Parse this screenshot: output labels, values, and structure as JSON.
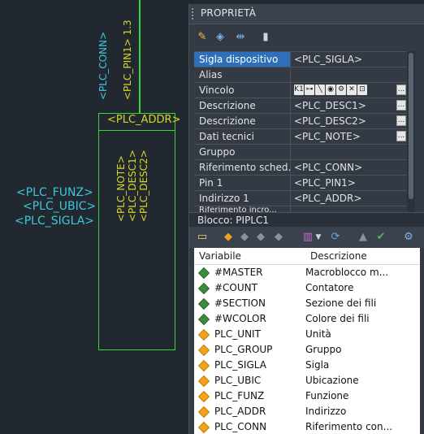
{
  "canvas": {
    "attributes": {
      "conn": "<PLC_CONN>",
      "pin1": "<PLC_PIN1> 1.3",
      "addr": "<PLC_ADDR>",
      "note": "<PLC_NOTE>",
      "desc1": "<PLC_DESC1>",
      "desc2": "<PLC_DESC2>",
      "funz": "<PLC_FUNZ>",
      "ubic": "<PLC_UBIC>",
      "sigla": "<PLC_SIGLA>"
    },
    "colors": {
      "wire": "#3fd23f",
      "yellow_text": "#d6d625",
      "cyan_text": "#3cc8d8"
    }
  },
  "panel": {
    "title": "PROPRIETÀ",
    "toolbar_icons": [
      "edit-properties-icon",
      "tag-icon",
      "connect-icon",
      "help-icon"
    ],
    "properties": [
      {
        "name": "Sigla dispositivo",
        "value": "<PLC_SIGLA>",
        "selected": true
      },
      {
        "name": "Alias",
        "value": ""
      },
      {
        "name": "Vincolo",
        "value": ""
      },
      {
        "name": "Descrizione",
        "value": "<PLC_DESC1>"
      },
      {
        "name": "Descrizione",
        "value": "<PLC_DESC2>"
      },
      {
        "name": "Dati tecnici",
        "value": "<PLC_NOTE>"
      },
      {
        "name": "Gruppo",
        "value": ""
      },
      {
        "name": "Riferimento sched...",
        "value": "<PLC_CONN>"
      },
      {
        "name": "Pin 1",
        "value": "<PLC_PIN1>"
      },
      {
        "name": "Indirizzo 1",
        "value": "<PLC_ADDR>"
      },
      {
        "name": "Riferimento incro...",
        "value": ""
      }
    ],
    "vincolo_icons": [
      "K1",
      "⊶",
      "╲",
      "◉",
      "⚙",
      "✕",
      "⊡"
    ],
    "block_label": "Blocco: PIPLC1",
    "variables": {
      "headers": {
        "name": "Variabile",
        "desc": "Descrizione"
      },
      "rows": [
        {
          "name": "#MASTER",
          "desc": "Macroblocco m...",
          "kind": "green"
        },
        {
          "name": "#COUNT",
          "desc": "Contatore",
          "kind": "green"
        },
        {
          "name": "#SECTION",
          "desc": "Sezione dei fili",
          "kind": "green"
        },
        {
          "name": "#WCOLOR",
          "desc": "Colore dei fili",
          "kind": "green"
        },
        {
          "name": "PLC_UNIT",
          "desc": "Unità",
          "kind": "orange"
        },
        {
          "name": "PLC_GROUP",
          "desc": "Gruppo",
          "kind": "orange"
        },
        {
          "name": "PLC_SIGLA",
          "desc": "Sigla",
          "kind": "orange"
        },
        {
          "name": "PLC_UBIC",
          "desc": "Ubicazione",
          "kind": "orange"
        },
        {
          "name": "PLC_FUNZ",
          "desc": "Funzione",
          "kind": "orange"
        },
        {
          "name": "PLC_ADDR",
          "desc": "Indirizzo",
          "kind": "orange"
        },
        {
          "name": "PLC_CONN",
          "desc": "Riferimento con...",
          "kind": "orange"
        }
      ]
    }
  }
}
